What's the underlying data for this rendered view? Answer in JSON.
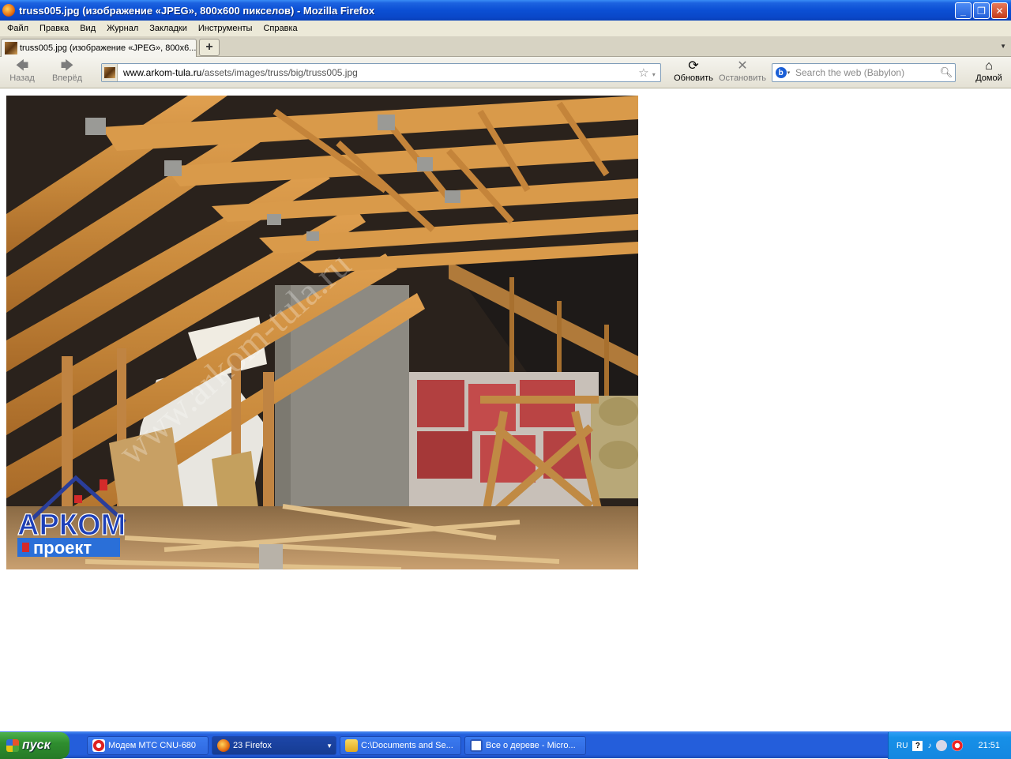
{
  "window": {
    "title": "truss005.jpg (изображение «JPEG», 800x600 пикселов) - Mozilla Firefox",
    "minimize": "_",
    "maximize": "❐",
    "close": "✕"
  },
  "menu": [
    "Файл",
    "Правка",
    "Вид",
    "Журнал",
    "Закладки",
    "Инструменты",
    "Справка"
  ],
  "tab": {
    "label": "truss005.jpg (изображение «JPEG», 800x6...",
    "new_tab": "+"
  },
  "nav": {
    "back": "Назад",
    "forward": "Вперёд",
    "reload": "Обновить",
    "stop": "Остановить",
    "home": "Домой",
    "url_domain": "www.arkom-tula.ru",
    "url_path": "/assets/images/truss/big/truss005.jpg",
    "search_placeholder": "Search the web (Babylon)"
  },
  "photo": {
    "watermark": "www.arkom-tula.ru",
    "logo_top": "АРКОМ",
    "logo_bottom": "проект"
  },
  "taskbar": {
    "start": "пуск",
    "tasks": [
      "Модем МТС CNU-680",
      "23 Firefox",
      "C:\\Documents and Se...",
      "Все о дереве - Micro..."
    ],
    "lang": "RU",
    "clock": "21:51"
  },
  "colors": {
    "titlebar": "#0b4fd4",
    "taskbar": "#245edb",
    "start": "#2f8e2f"
  }
}
